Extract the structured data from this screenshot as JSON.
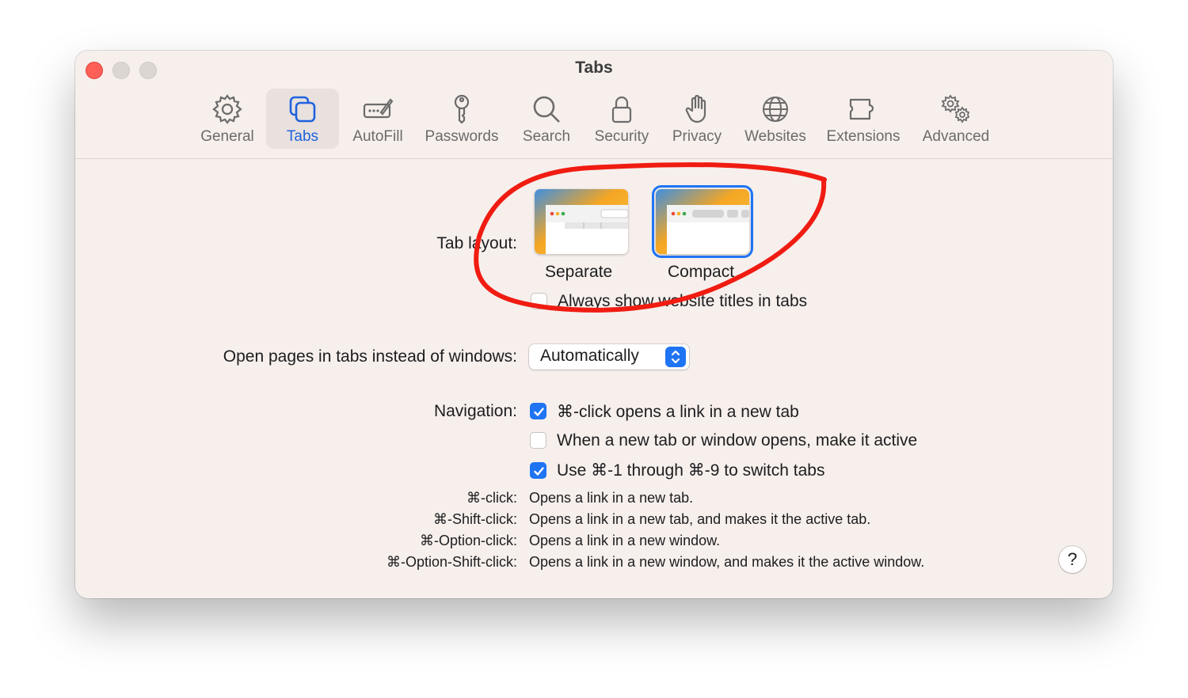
{
  "window": {
    "title": "Tabs"
  },
  "toolbar": {
    "items": [
      {
        "label": "General",
        "icon": "gear-icon"
      },
      {
        "label": "Tabs",
        "icon": "tabs-icon",
        "active": true
      },
      {
        "label": "AutoFill",
        "icon": "autofill-icon"
      },
      {
        "label": "Passwords",
        "icon": "key-icon"
      },
      {
        "label": "Search",
        "icon": "search-icon"
      },
      {
        "label": "Security",
        "icon": "lock-icon"
      },
      {
        "label": "Privacy",
        "icon": "hand-icon"
      },
      {
        "label": "Websites",
        "icon": "globe-icon"
      },
      {
        "label": "Extensions",
        "icon": "puzzle-icon"
      },
      {
        "label": "Advanced",
        "icon": "gears-icon"
      }
    ]
  },
  "tab_layout": {
    "label": "Tab layout:",
    "options": [
      {
        "label": "Separate",
        "selected": false
      },
      {
        "label": "Compact",
        "selected": true
      }
    ],
    "always_show_titles": {
      "label": "Always show website titles in tabs",
      "checked": false
    }
  },
  "open_pages": {
    "label": "Open pages in tabs instead of windows:",
    "value": "Automatically"
  },
  "navigation": {
    "label": "Navigation:",
    "options": [
      {
        "label": "⌘-click opens a link in a new tab",
        "checked": true
      },
      {
        "label": "When a new tab or window opens, make it active",
        "checked": false
      },
      {
        "label": "Use ⌘-1 through ⌘-9 to switch tabs",
        "checked": true
      }
    ]
  },
  "shortcuts": [
    {
      "key": "⌘-click:",
      "desc": "Opens a link in a new tab."
    },
    {
      "key": "⌘-Shift-click:",
      "desc": "Opens a link in a new tab, and makes it the active tab."
    },
    {
      "key": "⌘-Option-click:",
      "desc": "Opens a link in a new window."
    },
    {
      "key": "⌘-Option-Shift-click:",
      "desc": "Opens a link in a new window, and makes it the active window."
    }
  ],
  "help": {
    "label": "?"
  },
  "colors": {
    "accent": "#1f74f3",
    "annotation": "#f01c12",
    "window_bg": "#f6efec"
  }
}
